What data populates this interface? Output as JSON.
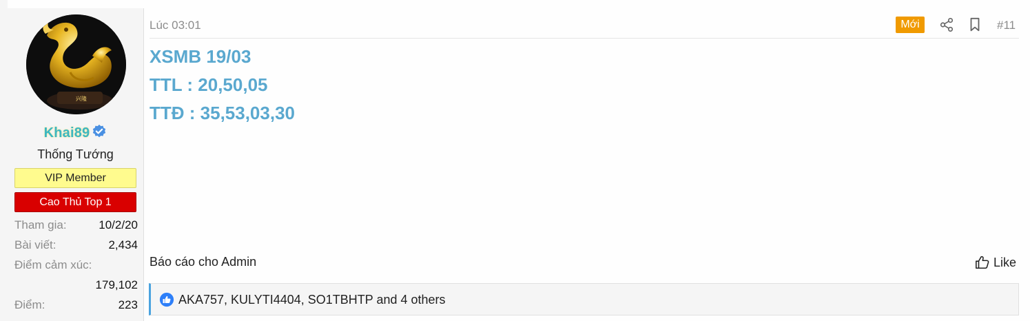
{
  "user": {
    "name": "Khai89",
    "title": "Thống Tướng",
    "banners": [
      "VIP Member",
      "Cao Thủ Top 1"
    ],
    "stats": [
      {
        "label": "Tham gia:",
        "value": "10/2/20"
      },
      {
        "label": "Bài viết:",
        "value": "2,434"
      },
      {
        "label": "Điểm cảm xúc:",
        "value": "179,102"
      },
      {
        "label": "Điểm:",
        "value": "223"
      }
    ]
  },
  "post": {
    "time": "Lúc 03:01",
    "new_badge": "Mới",
    "number": "#11",
    "lines": [
      "XSMB 19/03",
      "TTL : 20,50,05",
      "TTĐ : 35,53,03,30"
    ],
    "report_label": "Báo cáo cho Admin",
    "like_label": "Like",
    "reactions_text": "AKA757, KULYTI4404, SO1TBHTP and 4 others"
  },
  "colors": {
    "accent": "#5aa8cf",
    "username": "#3cb7c2",
    "new_badge": "#f09a00",
    "vip_banner": "#fffb8e",
    "top_banner": "#d90000"
  },
  "icons": {
    "verified": "verified-badge-icon",
    "share": "share-icon",
    "bookmark": "bookmark-icon",
    "like": "thumbs-up-icon",
    "reaction": "like-reaction-icon"
  }
}
